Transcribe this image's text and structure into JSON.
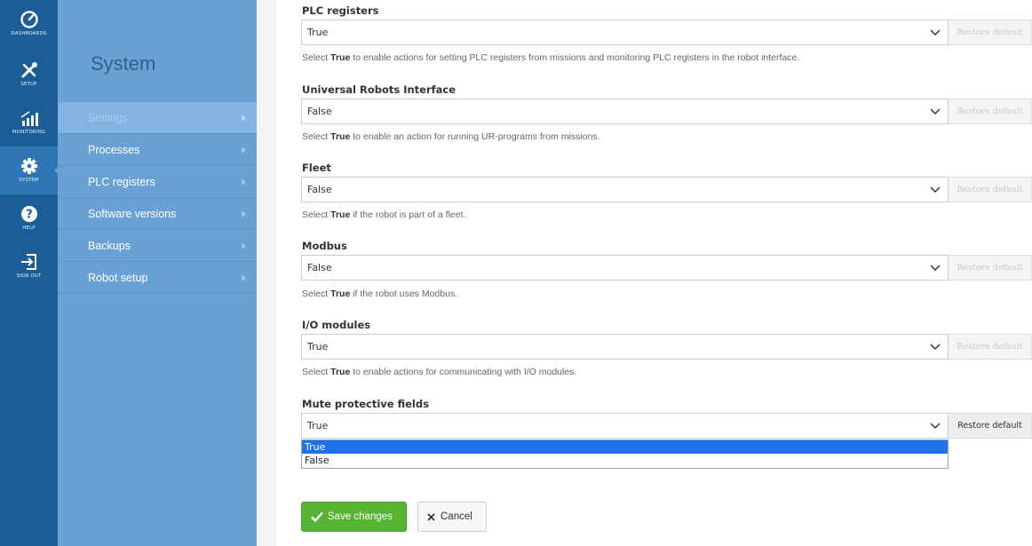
{
  "rail": {
    "items": [
      {
        "label": "DASHBOARDS",
        "icon": "speedometer-icon"
      },
      {
        "label": "SETUP",
        "icon": "tools-icon"
      },
      {
        "label": "MONITORING",
        "icon": "signal-bars-icon"
      },
      {
        "label": "SYSTEM",
        "icon": "gear-icon"
      },
      {
        "label": "HELP",
        "icon": "question-icon"
      },
      {
        "label": "SIGN OUT",
        "icon": "sign-out-icon"
      }
    ],
    "active_index": 3
  },
  "submenu": {
    "title": "System",
    "items": [
      {
        "label": "Settings",
        "active": true
      },
      {
        "label": "Processes"
      },
      {
        "label": "PLC registers"
      },
      {
        "label": "Software versions"
      },
      {
        "label": "Backups"
      },
      {
        "label": "Robot setup"
      }
    ]
  },
  "settings": [
    {
      "label": "PLC registers",
      "value": "True",
      "restore": "Restore default",
      "help_pre": "Select ",
      "help_bold": "True",
      "help_post": " to enable actions for setting PLC registers from missions and monitoring PLC registers in the robot interface."
    },
    {
      "label": "Universal Robots Interface",
      "value": "False",
      "restore": "Restore default",
      "help_pre": "Select ",
      "help_bold": "True",
      "help_post": " to enable an action for running UR-programs from missions."
    },
    {
      "label": "Fleet",
      "value": "False",
      "restore": "Restore default",
      "help_pre": "Select ",
      "help_bold": "True",
      "help_post": " if the robot is part of a fleet."
    },
    {
      "label": "Modbus",
      "value": "False",
      "restore": "Restore default",
      "help_pre": "Select ",
      "help_bold": "True",
      "help_post": " if the robot uses Modbus."
    },
    {
      "label": "I/O modules",
      "value": "True",
      "restore": "Restore default",
      "help_pre": "Select ",
      "help_bold": "True",
      "help_post": " to enable actions for communicating with I/O modules."
    },
    {
      "label": "Mute protective fields",
      "value": "True",
      "restore": "Restore default"
    }
  ],
  "dropdown": {
    "options": [
      "True",
      "False"
    ],
    "highlighted": "True"
  },
  "buttons": {
    "save": "Save changes",
    "cancel": "Cancel"
  },
  "colors": {
    "rail": "#1a5d97",
    "submenu": "#6aa1d4",
    "save": "#57b332",
    "highlight": "#1e73e8"
  }
}
